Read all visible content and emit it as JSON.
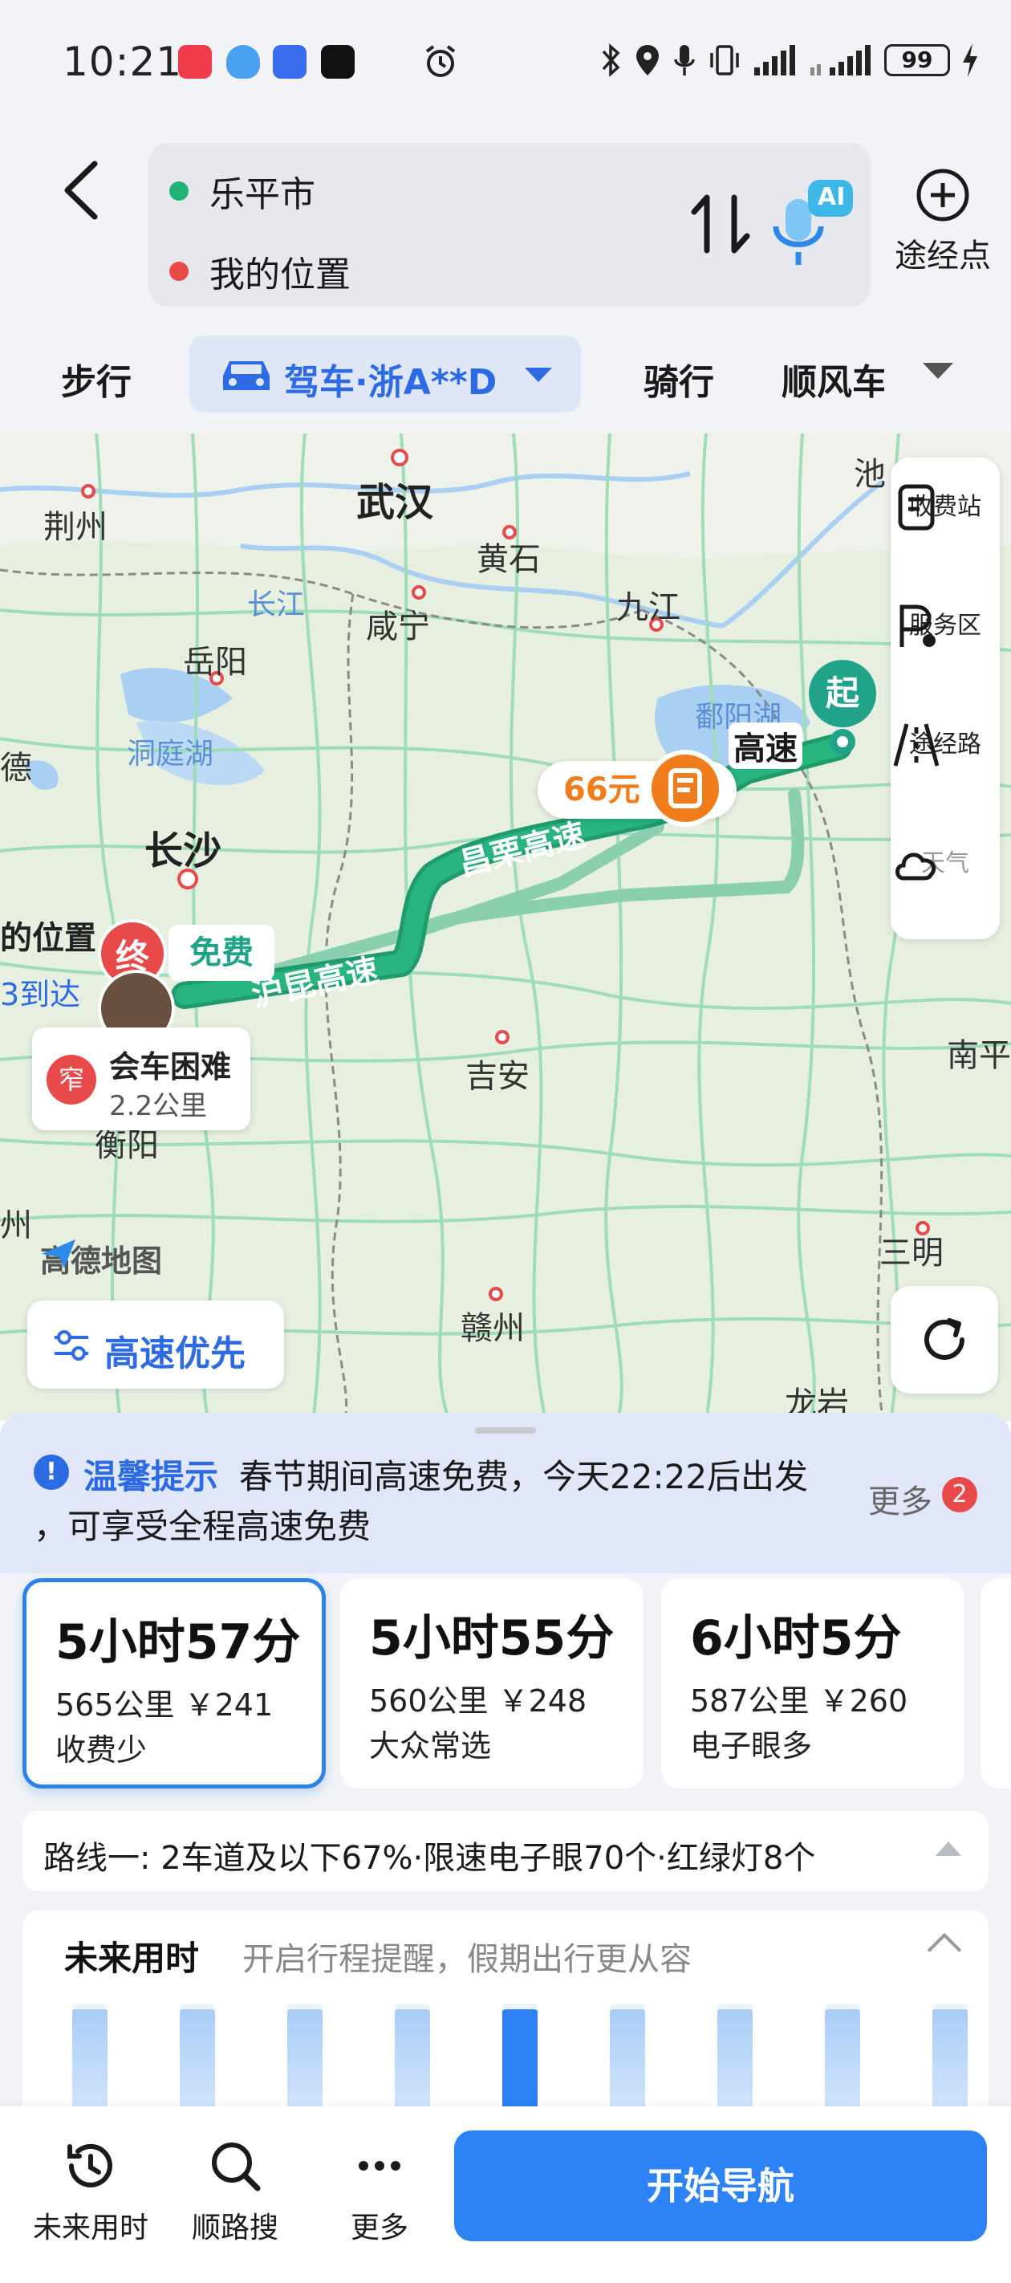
{
  "status_bar": {
    "time": "10:21",
    "battery": "99",
    "icons": [
      "xiaohongshu-icon",
      "shield-icon",
      "voice-icon",
      "tiktok-icon",
      "alarm-icon",
      "bluetooth-icon",
      "location-icon",
      "mic-icon",
      "vibrate-icon",
      "signal-icon",
      "signal-icon",
      "charging-icon"
    ]
  },
  "header": {
    "origin": "乐平市",
    "destination": "我的位置",
    "waypoint_label": "途经点",
    "ai_label": "AI",
    "colors": {
      "origin_dot": "#1fb57a",
      "destination_dot": "#e84a4a"
    }
  },
  "modes": {
    "walk": "步行",
    "drive": "驾车·浙A**D",
    "ride": "骑行",
    "carpool": "顺风车"
  },
  "map": {
    "cities": {
      "wuhan": "武汉",
      "jingzhou": "荆州",
      "huangshi": "黄石",
      "chi": "池",
      "xianning": "咸宁",
      "jiujiang": "九江",
      "yueyang": "岳阳",
      "changsha": "长沙",
      "hengyang": "衡阳",
      "jian": "吉安",
      "ganzhou": "赣州",
      "sanming": "三明",
      "nanping": "南平",
      "longyan": "龙岩",
      "de": "德",
      "zhou": "州",
      "fu": "赣"
    },
    "water": {
      "changjiang": "长江",
      "dongting": "洞庭湖",
      "poyang": "鄱阳湖"
    },
    "roads": {
      "changli": "昌栗高速",
      "hukun": "沪昆高速",
      "gaosu": "高速"
    },
    "right_panel": [
      {
        "label": "收费站",
        "icon": "toll-station-icon"
      },
      {
        "label": "服务区",
        "icon": "service-area-icon"
      },
      {
        "label": "途经路",
        "icon": "road-icon"
      },
      {
        "label": "天气",
        "icon": "weather-icon"
      }
    ],
    "toll_price": "66元",
    "start_label": "起",
    "end_label": "终",
    "free_label": "免费",
    "my_location": "的位置",
    "arrive": "3到达",
    "narrow": {
      "badge": "窄",
      "title": "会车困难",
      "distance": "2.2公里"
    },
    "logo": "高德地图",
    "preference": "高速优先"
  },
  "notice": {
    "title": "温馨提示",
    "text1": "春节期间高速免费，今天22:22后出发",
    "text2": "，可享受全程高速免费",
    "more": "更多",
    "count": "2"
  },
  "routes": [
    {
      "time": "5小时57分",
      "distance": "565公里",
      "price": "￥241",
      "tag": "收费少",
      "selected": true
    },
    {
      "time": "5小时55分",
      "distance": "560公里",
      "price": "￥248",
      "tag": "大众常选",
      "selected": false
    },
    {
      "time": "6小时5分",
      "distance": "587公里",
      "price": "￥260",
      "tag": "电子眼多",
      "selected": false
    }
  ],
  "route_detail": "路线一:  2车道及以下67%·限速电子眼70个·红绿灯8个",
  "future": {
    "title": "未来用时",
    "subtitle": "开启行程提醒，假期出行更从容",
    "bars": [
      0.95,
      0.95,
      0.95,
      0.95,
      0.95,
      0.95,
      0.95,
      0.95,
      0.95
    ],
    "highlight_index": 4
  },
  "bottom_nav": {
    "future": "未来用时",
    "along": "顺路搜",
    "more": "更多",
    "start": "开始导航"
  },
  "colors": {
    "accent": "#2d82f5",
    "route_green": "#1fa67a",
    "toll_orange": "#f07c1c",
    "alert_red": "#e84a4a"
  }
}
